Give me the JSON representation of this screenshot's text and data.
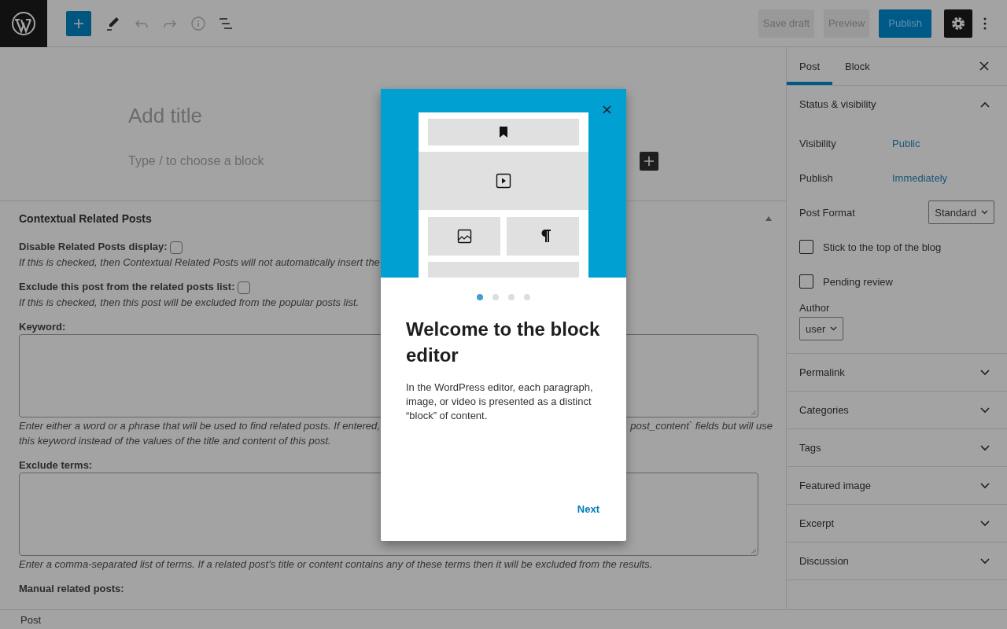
{
  "toolbar": {
    "buttons": [
      {
        "label": "Save draft",
        "kind": "tertiary"
      },
      {
        "label": "Preview",
        "kind": "tertiary"
      },
      {
        "label": "Publish",
        "kind": "primary"
      }
    ],
    "settings_pressed": true
  },
  "editor": {
    "title_placeholder": "Add title",
    "block_placeholder": "Type / to choose a block"
  },
  "metabox": {
    "title": "Contextual Related Posts",
    "expanded": true,
    "fields": [
      {
        "kind": "checkbox",
        "label": "Disable Related Posts display:",
        "checked": false,
        "help_lines": [
          [
            "If this is checked, then Contextual Related Posts will not automatically insert the"
          ]
        ]
      },
      {
        "kind": "checkbox",
        "label": "Exclude this post from the related posts list:",
        "checked": false,
        "help_lines": [
          [
            "If this is checked, then this post will be excluded from the popular posts list."
          ]
        ]
      },
      {
        "kind": "textarea",
        "label": "Keyword:",
        "help_lines": [
          [
            "Enter either a word or a phrase that will be used to find related posts. If entered,",
            "post_content` fields but will use"
          ],
          [
            "this keyword instead of the values of the title and content of this post."
          ]
        ]
      },
      {
        "kind": "textarea",
        "label": "Exclude terms:",
        "help_lines": [
          [
            "Enter a comma-separated list of terms. If a related post's title or content contains any of these terms then it will be excluded from the results."
          ]
        ]
      },
      {
        "kind": "heading",
        "label": "Manual related posts:"
      }
    ]
  },
  "sidebar": {
    "tabs": [
      {
        "label": "Post",
        "selected": true
      },
      {
        "label": "Block",
        "selected": false
      }
    ],
    "panels": [
      {
        "title": "Status & visibility",
        "expanded": true,
        "rows": [
          {
            "kind": "link",
            "label": "Visibility",
            "value": "Public"
          },
          {
            "kind": "link",
            "label": "Publish",
            "value": "Immediately"
          },
          {
            "kind": "select",
            "label": "Post Format",
            "value": "Standard"
          }
        ],
        "checkboxes": [
          {
            "label": "Stick to the top of the blog",
            "checked": false
          },
          {
            "label": "Pending review",
            "checked": false
          }
        ],
        "author": {
          "label": "Author",
          "value": "user"
        }
      },
      {
        "title": "Permalink",
        "expanded": false
      },
      {
        "title": "Categories",
        "expanded": false
      },
      {
        "title": "Tags",
        "expanded": false
      },
      {
        "title": "Featured image",
        "expanded": false
      },
      {
        "title": "Excerpt",
        "expanded": false
      },
      {
        "title": "Discussion",
        "expanded": false
      }
    ]
  },
  "modal": {
    "title": "Welcome to the block editor",
    "body": "In the WordPress editor, each paragraph, image, or video is presented as a distinct “block” of content.",
    "pages": [
      {
        "selected": true
      },
      {
        "selected": false
      },
      {
        "selected": false
      },
      {
        "selected": false
      }
    ],
    "next_label": "Next"
  },
  "status_bar": {
    "breadcrumb": "Post"
  }
}
